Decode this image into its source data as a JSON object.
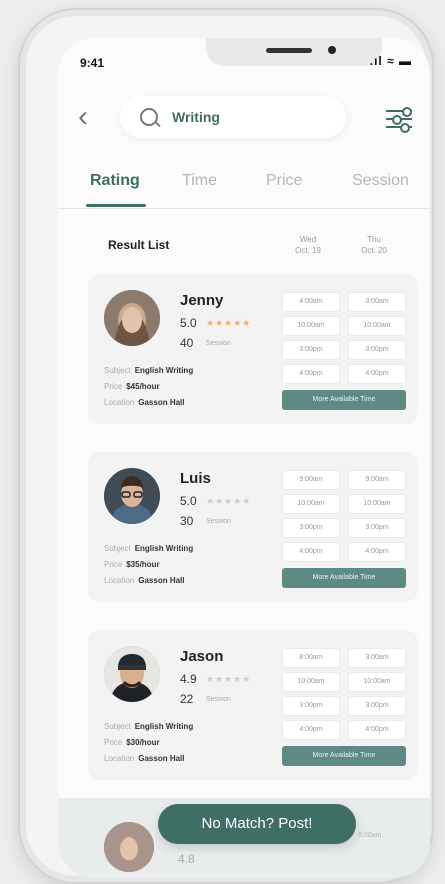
{
  "status_bar": {
    "time": "9:41",
    "icons": ".ıl ≈ ▬"
  },
  "search": {
    "query": "Writing"
  },
  "tabs": [
    {
      "label": "Rating"
    },
    {
      "label": "Time"
    },
    {
      "label": "Price"
    },
    {
      "label": "Session"
    }
  ],
  "results": {
    "title": "Result List",
    "dates": [
      {
        "day": "Wed",
        "date": "Oct. 19"
      },
      {
        "day": "Thu",
        "date": "Oct. 20"
      }
    ]
  },
  "tutors": [
    {
      "name": "Jenny",
      "rating": "5.0",
      "stars": "★★★★★",
      "sessions": "40",
      "sessions_label": "Session",
      "subject_label": "Subject",
      "subject": "English Writing",
      "price_label": "Price",
      "price": "$45/hour",
      "location_label": "Location",
      "location": "Gasson Hall",
      "slots": [
        [
          "4:00am",
          "3:00am"
        ],
        [
          "10:00am",
          "10:00am"
        ],
        [
          "3:00pm",
          "3:00pm"
        ],
        [
          "4:00pm",
          "4:00pm"
        ]
      ],
      "more": "More Available Time"
    },
    {
      "name": "Luis",
      "rating": "5.0",
      "stars": "★★★★★",
      "sessions": "30",
      "sessions_label": "Session",
      "subject_label": "Subject",
      "subject": "English Writing",
      "price_label": "Price",
      "price": "$35/hour",
      "location_label": "Location",
      "location": "Gasson Hall",
      "slots": [
        [
          "9:00am",
          "9:00am"
        ],
        [
          "10:00am",
          "10:00am"
        ],
        [
          "3:00pm",
          "3:00pm"
        ],
        [
          "4:00pm",
          "4:00pm"
        ]
      ],
      "more": "More Available Time"
    },
    {
      "name": "Jason",
      "rating": "4.9",
      "stars": "★★★★★",
      "sessions": "22",
      "sessions_label": "Session",
      "subject_label": "Subject",
      "subject": "English Writing",
      "price_label": "Price",
      "price": "$30/hour",
      "location_label": "Location",
      "location": "Gasson Hall",
      "slots": [
        [
          "8:00am",
          "3:00am"
        ],
        [
          "10:00am",
          "10:00am"
        ],
        [
          "3:00pm",
          "3:00pm"
        ],
        [
          "4:00pm",
          "4:00pm"
        ]
      ],
      "more": "More Available Time"
    }
  ],
  "peek": {
    "rating": "4.8",
    "slot": "8:00am"
  },
  "cta": {
    "label": "No Match? Post!"
  },
  "colors": {
    "brand": "#3f6f63",
    "button": "#5d8b83",
    "star": "#e7b46b"
  }
}
